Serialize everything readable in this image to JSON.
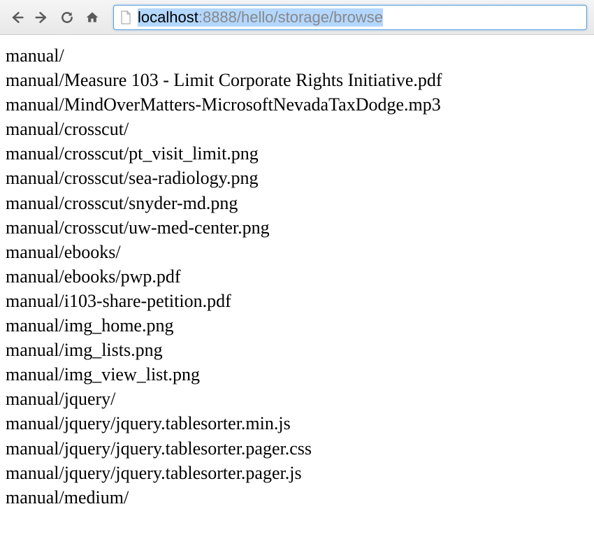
{
  "address_bar": {
    "url_host": "localhost",
    "url_port_path": ":8888/hello/storage/browse"
  },
  "files": [
    "manual/",
    "manual/Measure 103 - Limit Corporate Rights Initiative.pdf",
    "manual/MindOverMatters-MicrosoftNevadaTaxDodge.mp3",
    "manual/crosscut/",
    "manual/crosscut/pt_visit_limit.png",
    "manual/crosscut/sea-radiology.png",
    "manual/crosscut/snyder-md.png",
    "manual/crosscut/uw-med-center.png",
    "manual/ebooks/",
    "manual/ebooks/pwp.pdf",
    "manual/i103-share-petition.pdf",
    "manual/img_home.png",
    "manual/img_lists.png",
    "manual/img_view_list.png",
    "manual/jquery/",
    "manual/jquery/jquery.tablesorter.min.js",
    "manual/jquery/jquery.tablesorter.pager.css",
    "manual/jquery/jquery.tablesorter.pager.js",
    "manual/medium/"
  ]
}
